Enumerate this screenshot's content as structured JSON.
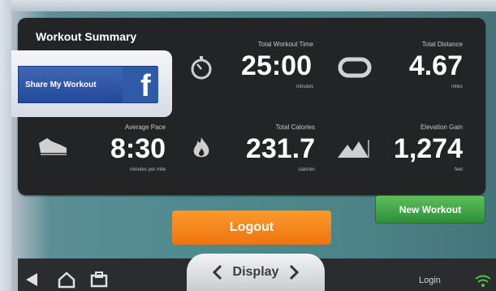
{
  "summary": {
    "title": "Workout Summary",
    "share_label": "Share My Workout",
    "facebook_glyph": "f"
  },
  "stats": {
    "time": {
      "label": "Total Workout Time",
      "value": "25:00",
      "unit": "minutes"
    },
    "distance": {
      "label": "Total Distance",
      "value": "4.67",
      "unit": "miles"
    },
    "pace": {
      "label": "Average Pace",
      "value": "8:30",
      "unit": "minutes per mile"
    },
    "calories": {
      "label": "Total Calories",
      "value": "231.7",
      "unit": "calories"
    },
    "elevation": {
      "label": "Elevation Gain",
      "value": "1,274",
      "unit": "feet"
    }
  },
  "buttons": {
    "new_workout": "New Workout",
    "logout": "Logout"
  },
  "bottom": {
    "display_label": "Display",
    "login_label": "Login"
  },
  "colors": {
    "panel": "#232426",
    "facebook_blue": "#2f5aa7",
    "new_workout_green": "#3fa846",
    "logout_orange": "#f58a1f"
  },
  "icons": {
    "time": "stopwatch-icon",
    "distance": "track-icon",
    "pace": "shoe-icon",
    "calories": "flame-icon",
    "elevation": "mountain-icon"
  }
}
